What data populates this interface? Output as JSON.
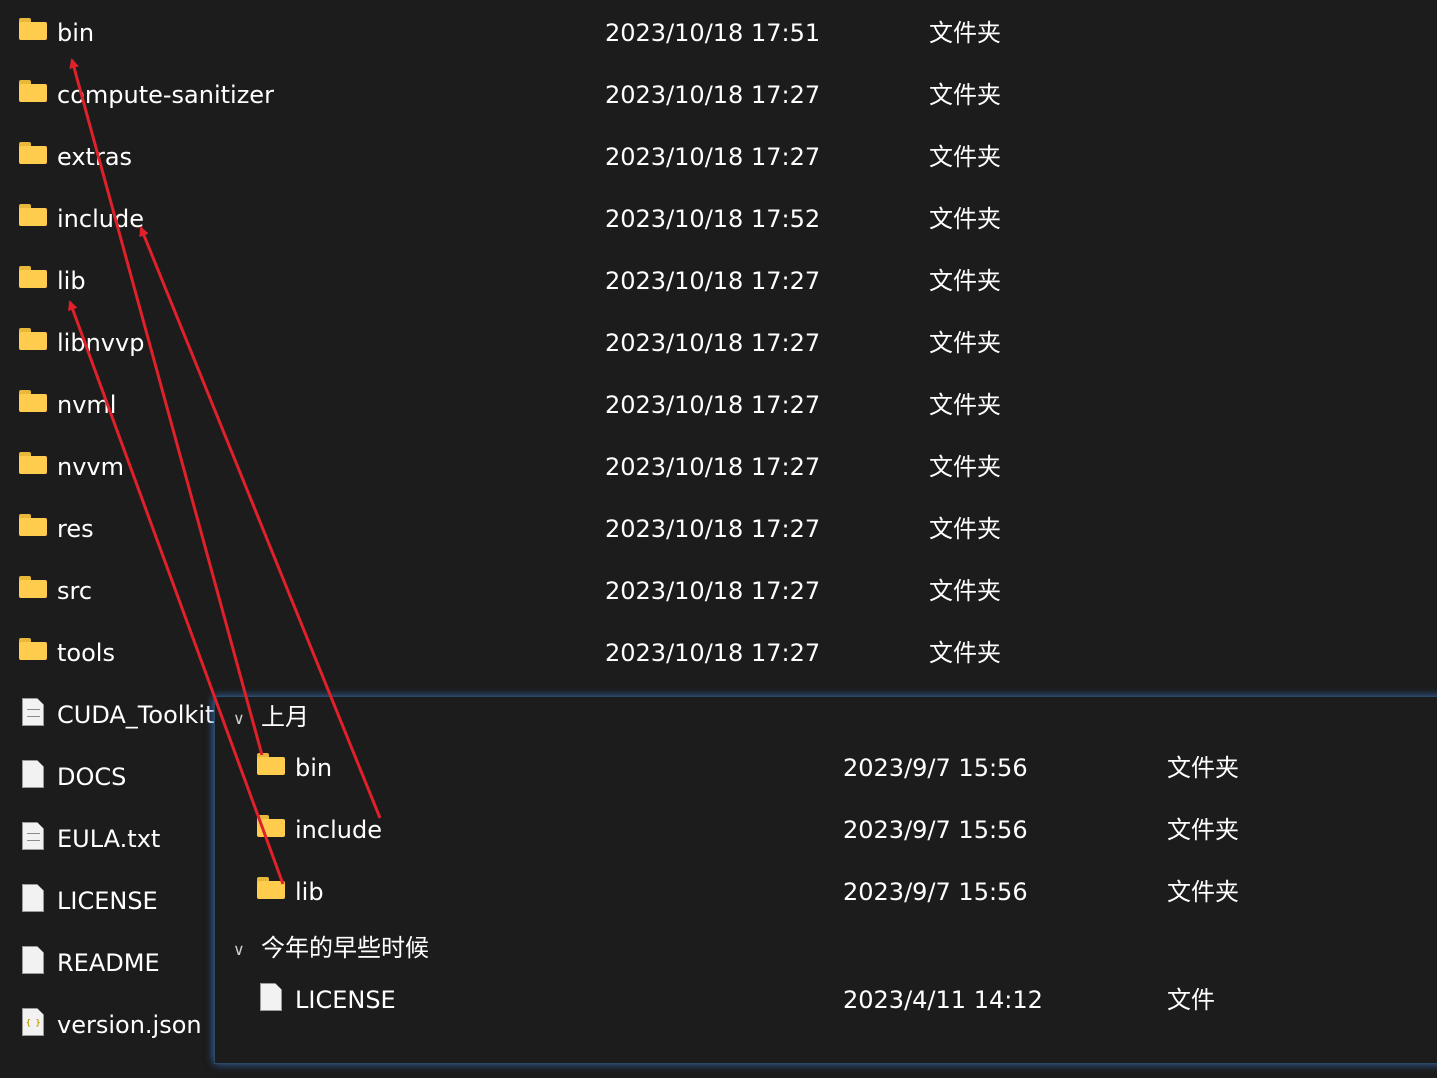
{
  "files": [
    {
      "name": "bin",
      "date": "2023/10/18 17:51",
      "type": "文件夹",
      "icon": "folder-icon"
    },
    {
      "name": "compute-sanitizer",
      "date": "2023/10/18 17:27",
      "type": "文件夹",
      "icon": "folder-icon"
    },
    {
      "name": "extras",
      "date": "2023/10/18 17:27",
      "type": "文件夹",
      "icon": "folder-icon"
    },
    {
      "name": "include",
      "date": "2023/10/18 17:52",
      "type": "文件夹",
      "icon": "folder-icon"
    },
    {
      "name": "lib",
      "date": "2023/10/18 17:27",
      "type": "文件夹",
      "icon": "folder-icon"
    },
    {
      "name": "libnvvp",
      "date": "2023/10/18 17:27",
      "type": "文件夹",
      "icon": "folder-icon"
    },
    {
      "name": "nvml",
      "date": "2023/10/18 17:27",
      "type": "文件夹",
      "icon": "folder-icon"
    },
    {
      "name": "nvvm",
      "date": "2023/10/18 17:27",
      "type": "文件夹",
      "icon": "folder-icon"
    },
    {
      "name": "res",
      "date": "2023/10/18 17:27",
      "type": "文件夹",
      "icon": "folder-icon"
    },
    {
      "name": "src",
      "date": "2023/10/18 17:27",
      "type": "文件夹",
      "icon": "folder-icon"
    },
    {
      "name": "tools",
      "date": "2023/10/18 17:27",
      "type": "文件夹",
      "icon": "folder-icon"
    },
    {
      "name": "CUDA_Toolkit",
      "icon": "text-file-icon"
    },
    {
      "name": "DOCS",
      "icon": "file-icon"
    },
    {
      "name": "EULA.txt",
      "icon": "text-file-icon"
    },
    {
      "name": "LICENSE",
      "icon": "file-icon"
    },
    {
      "name": "README",
      "icon": "file-icon"
    },
    {
      "name": "version.json",
      "icon": "json-file-icon"
    }
  ],
  "overlay": {
    "groups": [
      {
        "label": "上月",
        "items": [
          {
            "name": "bin",
            "date": "2023/9/7 15:56",
            "type": "文件夹",
            "icon": "folder-icon"
          },
          {
            "name": "include",
            "date": "2023/9/7 15:56",
            "type": "文件夹",
            "icon": "folder-icon"
          },
          {
            "name": "lib",
            "date": "2023/9/7 15:56",
            "type": "文件夹",
            "icon": "folder-icon"
          }
        ]
      },
      {
        "label": "今年的早些时候",
        "items": [
          {
            "name": "LICENSE",
            "date": "2023/4/11 14:12",
            "type": "文件",
            "icon": "file-icon"
          }
        ]
      }
    ]
  },
  "colors": {
    "background": "#1c1c1c",
    "folder": "#ffcc4d",
    "annotation_arrow": "#e0202a",
    "overlay_glow": "#3c78c8"
  }
}
